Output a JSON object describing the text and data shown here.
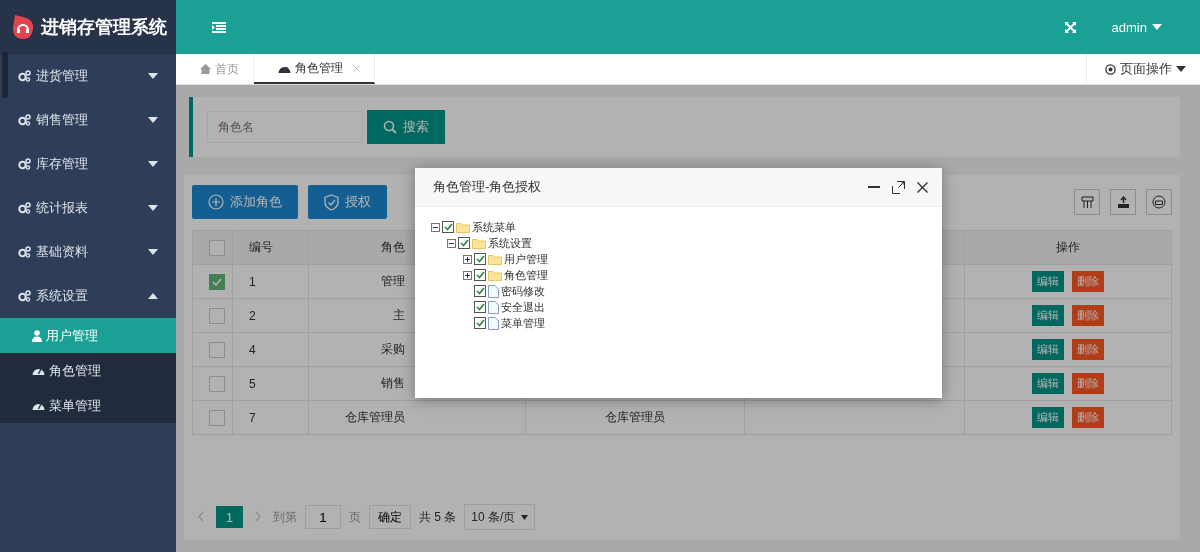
{
  "app": {
    "title": "进销存管理系统"
  },
  "sidebar": {
    "items": [
      {
        "label": "进货管理",
        "expanded": false
      },
      {
        "label": "销售管理",
        "expanded": false
      },
      {
        "label": "库存管理",
        "expanded": false
      },
      {
        "label": "统计报表",
        "expanded": false
      },
      {
        "label": "基础资料",
        "expanded": false
      },
      {
        "label": "系统设置",
        "expanded": true,
        "children": [
          {
            "label": "用户管理",
            "kind": "user",
            "selected": true
          },
          {
            "label": "角色管理",
            "kind": "gauge",
            "selected": false
          },
          {
            "label": "菜单管理",
            "kind": "gauge",
            "selected": false
          }
        ]
      }
    ]
  },
  "header": {
    "user": "admin"
  },
  "tabs": [
    {
      "label": "首页",
      "kind": "home",
      "selected": false,
      "closable": false
    },
    {
      "label": "角色管理",
      "kind": "gauge",
      "selected": true,
      "closable": true
    }
  ],
  "page_actions": "页面操作",
  "search": {
    "placeholder": "角色名",
    "button": "搜索"
  },
  "toolbar": {
    "buttons": [
      {
        "label": "添加角色",
        "kind": "add"
      },
      {
        "label": "授权",
        "kind": "shield"
      }
    ]
  },
  "table": {
    "columns": [
      "编号",
      "角色",
      "操作"
    ],
    "header_checked": false,
    "rows": [
      {
        "checked": true,
        "id": "1",
        "role": "管理",
        "actions": [
          "编辑",
          "删除"
        ]
      },
      {
        "checked": false,
        "id": "2",
        "role": "主",
        "actions": [
          "编辑",
          "删除"
        ]
      },
      {
        "checked": false,
        "id": "4",
        "role": "采购",
        "actions": [
          "编辑",
          "删除"
        ]
      },
      {
        "checked": false,
        "id": "5",
        "role": "销售",
        "actions": [
          "编辑",
          "删除"
        ]
      },
      {
        "checked": false,
        "id": "7",
        "role": "仓库管理员",
        "column_4": "仓库管理员",
        "actions": [
          "编辑",
          "删除"
        ]
      }
    ]
  },
  "pagination": {
    "pages": [
      {
        "label": "1",
        "selected": true
      }
    ],
    "goto_label": "到第",
    "goto_value": "1",
    "page_unit": "页",
    "confirm": "确定",
    "total": "共 5 条",
    "page_size": "10 条/页"
  },
  "dialog": {
    "title": "角色管理-角色授权",
    "tree": [
      {
        "label": "系统菜单",
        "kind": "folder",
        "checked": true,
        "expanded": true,
        "children": [
          {
            "label": "系统设置",
            "kind": "folder",
            "checked": true,
            "expanded": true,
            "children": [
              {
                "label": "用户管理",
                "kind": "folder",
                "checked": true,
                "expanded": false
              },
              {
                "label": "角色管理",
                "kind": "folder",
                "checked": true,
                "expanded": false
              },
              {
                "label": "密码修改",
                "kind": "file",
                "checked": true
              },
              {
                "label": "安全退出",
                "kind": "file",
                "checked": true
              },
              {
                "label": "菜单管理",
                "kind": "file",
                "checked": true
              }
            ]
          }
        ]
      }
    ]
  }
}
